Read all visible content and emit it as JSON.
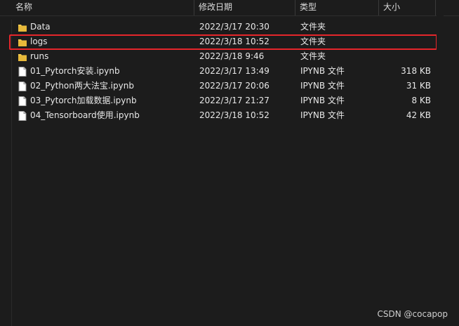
{
  "columns": {
    "name": "名称",
    "date": "修改日期",
    "type": "类型",
    "size": "大小"
  },
  "files": [
    {
      "name": "Data",
      "date": "2022/3/17 20:30",
      "type": "文件夹",
      "size": "",
      "icon": "folder-icon"
    },
    {
      "name": "logs",
      "date": "2022/3/18 10:52",
      "type": "文件夹",
      "size": "",
      "icon": "folder-icon"
    },
    {
      "name": "runs",
      "date": "2022/3/18 9:46",
      "type": "文件夹",
      "size": "",
      "icon": "folder-icon"
    },
    {
      "name": "01_Pytorch安装.ipynb",
      "date": "2022/3/17 13:49",
      "type": "IPYNB 文件",
      "size": "318 KB",
      "icon": "document-icon"
    },
    {
      "name": "02_Python两大法宝.ipynb",
      "date": "2022/3/17 20:06",
      "type": "IPYNB 文件",
      "size": "31 KB",
      "icon": "document-icon"
    },
    {
      "name": "03_Pytorch加载数据.ipynb",
      "date": "2022/3/17 21:27",
      "type": "IPYNB 文件",
      "size": "8 KB",
      "icon": "document-icon"
    },
    {
      "name": "04_Tensorboard使用.ipynb",
      "date": "2022/3/18 10:52",
      "type": "IPYNB 文件",
      "size": "42 KB",
      "icon": "document-icon"
    }
  ],
  "colors": {
    "background": "#1c1c1c",
    "text": "#e8e8e8",
    "folder": "#f2c94c",
    "highlight": "#e5262b"
  },
  "watermark": "CSDN @cocapop"
}
